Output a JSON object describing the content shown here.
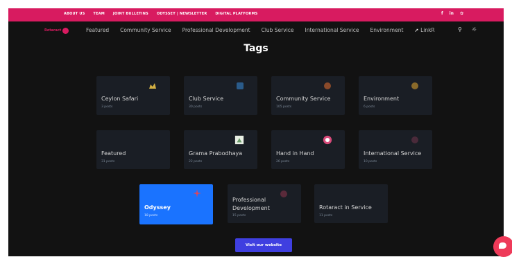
{
  "topbar": {
    "links": [
      "ABOUT US",
      "TEAM",
      "JOINT BULLETINS",
      "ODYSSEY | NEWSLETTER",
      "DIGITAL PLATFORMS"
    ],
    "social": [
      "facebook-icon",
      "linkedin-icon",
      "twitter-icon"
    ]
  },
  "navbar": {
    "logo_text": "Rotaract",
    "items": [
      "Featured",
      "Community Service",
      "Professional Development",
      "Club Service",
      "International Service",
      "Environment",
      "LinkR"
    ],
    "icons": [
      "search-icon",
      "theme-toggle-icon"
    ]
  },
  "page": {
    "title": "Tags"
  },
  "tags": [
    {
      "label": "Ceylon Safari",
      "count": "3 posts",
      "icon": "safari-icon",
      "icon_color": "#d4b043"
    },
    {
      "label": "Club Service",
      "count": "30 posts",
      "icon": "club-service-icon",
      "icon_color": "#2a5b8a"
    },
    {
      "label": "Community Service",
      "count": "105 posts",
      "icon": "community-service-icon",
      "icon_color": "#8a4a2a"
    },
    {
      "label": "Environment",
      "count": "6 posts",
      "icon": "environment-icon",
      "icon_color": "#8a6a2a"
    },
    {
      "label": "Featured",
      "count": "31 posts",
      "icon": "",
      "icon_color": ""
    },
    {
      "label": "Grama Prabodhaya",
      "count": "22 posts",
      "icon": "grama-prabodhaya-icon",
      "icon_color": "#6a9a6a"
    },
    {
      "label": "Hand in Hand",
      "count": "26 posts",
      "icon": "hand-in-hand-icon",
      "icon_color": "#d84a7a"
    },
    {
      "label": "International Service",
      "count": "10 posts",
      "icon": "international-service-icon",
      "icon_color": "#4a2a3a"
    },
    {
      "label": "Odyssey",
      "count": "18 posts",
      "icon": "odyssey-icon",
      "icon_color": "#e0455a",
      "active": true
    },
    {
      "label": "Professional Development",
      "count": "15 posts",
      "icon": "professional-development-icon",
      "icon_color": "#5a2a3a"
    },
    {
      "label": "Rotaract in Service",
      "count": "11 posts",
      "icon": "",
      "icon_color": ""
    }
  ],
  "cta": {
    "label": "Visit our website"
  },
  "chat": {
    "icon": "chat-icon"
  }
}
